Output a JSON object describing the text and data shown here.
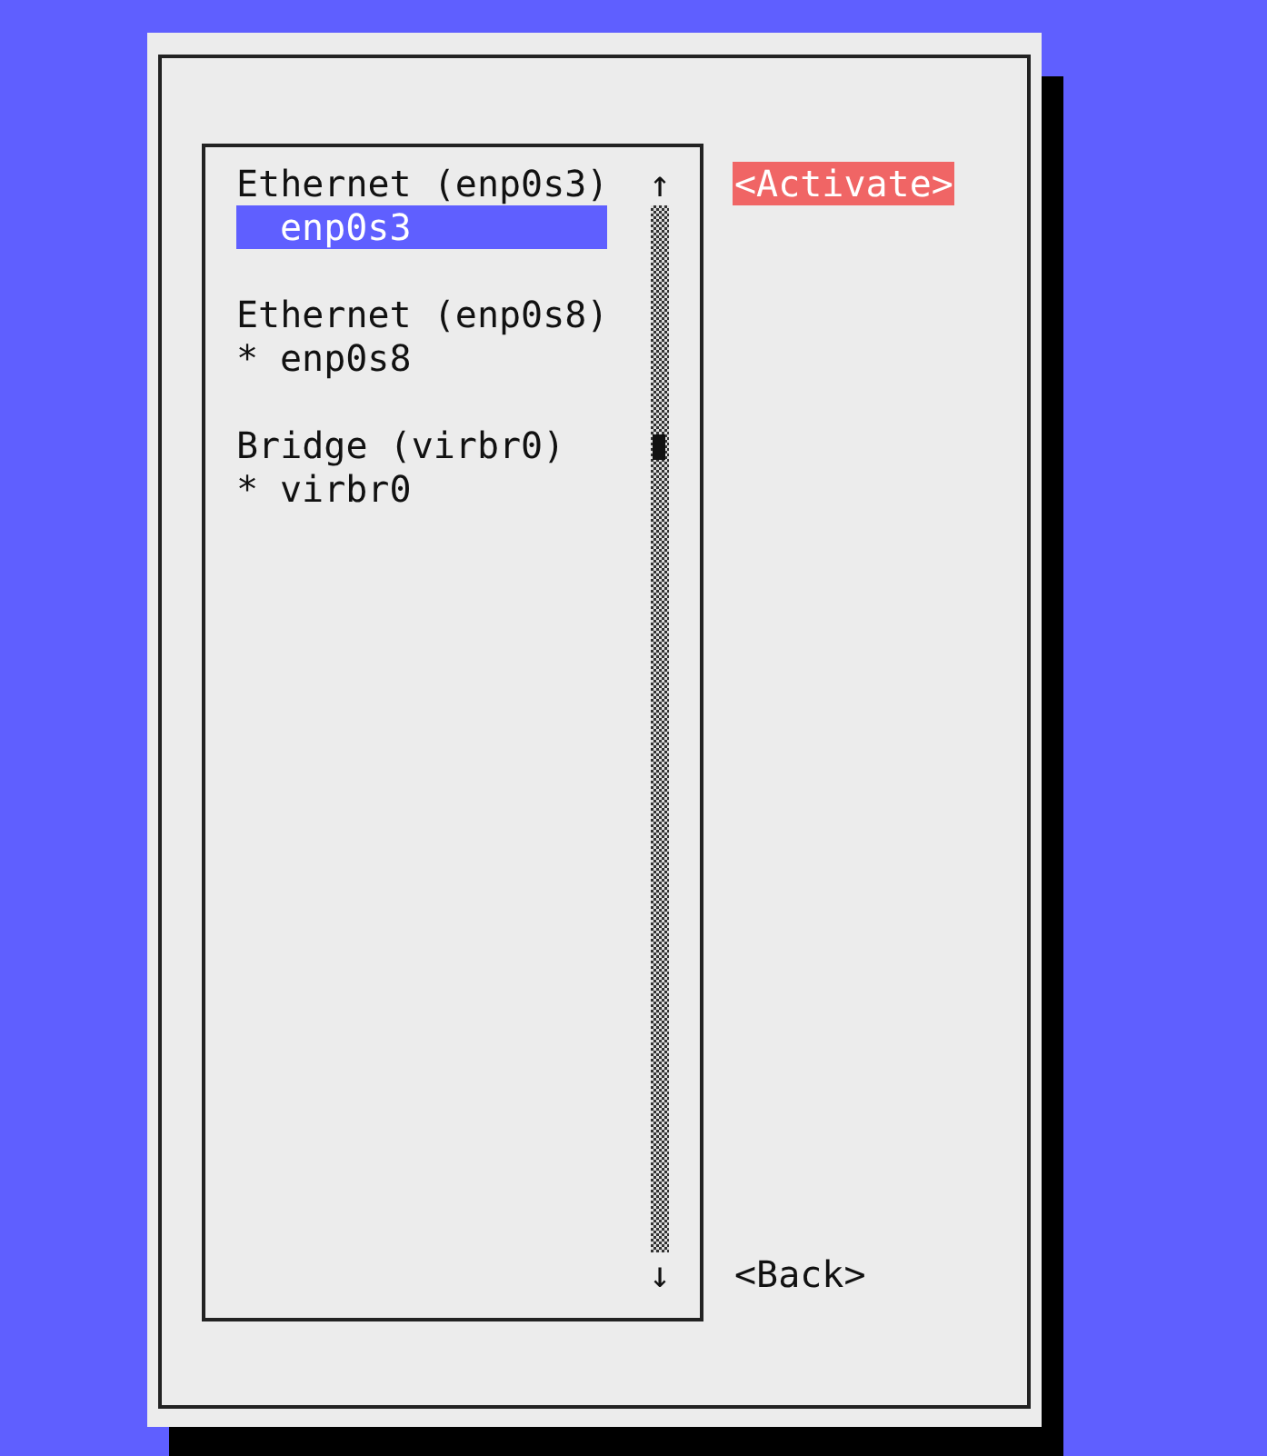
{
  "connections": [
    {
      "header": "Ethernet (enp0s3)",
      "items": [
        {
          "marker": "",
          "name": "enp0s3",
          "selected": true
        }
      ]
    },
    {
      "header": "Ethernet (enp0s8)",
      "items": [
        {
          "marker": "*",
          "name": "enp0s8",
          "selected": false
        }
      ]
    },
    {
      "header": "Bridge (virbr0)",
      "items": [
        {
          "marker": "*",
          "name": "virbr0",
          "selected": false
        }
      ]
    }
  ],
  "scrollbar": {
    "up": "↑",
    "down": "↓"
  },
  "buttons": [
    {
      "label": "<Activate>",
      "selected": true
    },
    {
      "label": "<Back>",
      "selected": false
    }
  ]
}
